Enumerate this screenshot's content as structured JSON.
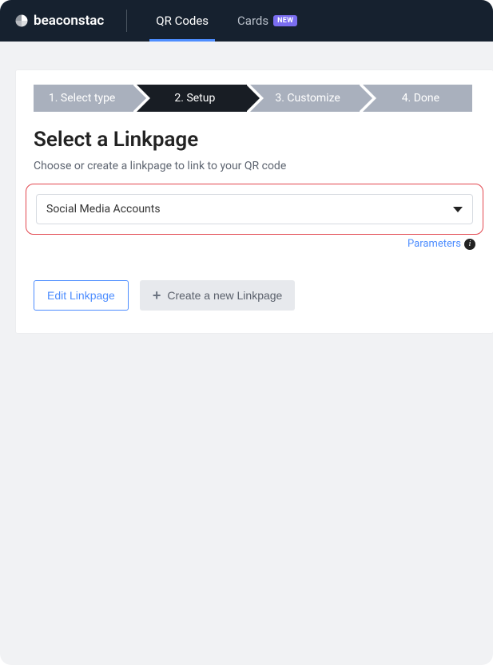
{
  "brand": {
    "name": "beaconstac"
  },
  "nav": {
    "qr": "QR Codes",
    "cards": "Cards",
    "badge_new": "NEW"
  },
  "stepper": {
    "s1": "1. Select type",
    "s2": "2. Setup",
    "s3": "3. Customize",
    "s4": "4. Done"
  },
  "page": {
    "title": "Select a Linkpage",
    "desc": "Choose or create a linkpage to link to your QR code"
  },
  "select": {
    "value": "Social Media Accounts"
  },
  "links": {
    "parameters": "Parameters"
  },
  "buttons": {
    "edit": "Edit Linkpage",
    "create": "Create a new Linkpage"
  }
}
